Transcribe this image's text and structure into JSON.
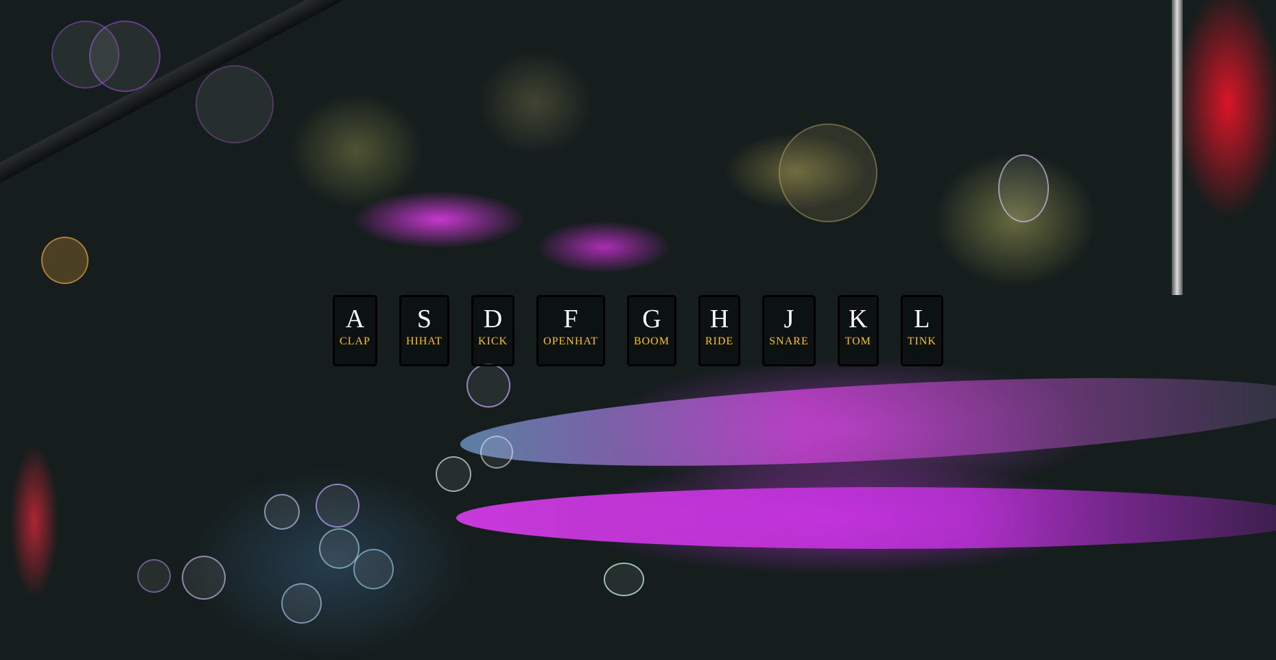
{
  "keys": [
    {
      "letter": "A",
      "sound": "CLAP"
    },
    {
      "letter": "S",
      "sound": "HIHAT"
    },
    {
      "letter": "D",
      "sound": "KICK"
    },
    {
      "letter": "F",
      "sound": "OPENHAT"
    },
    {
      "letter": "G",
      "sound": "BOOM"
    },
    {
      "letter": "H",
      "sound": "RIDE"
    },
    {
      "letter": "J",
      "sound": "SNARE"
    },
    {
      "letter": "K",
      "sound": "TOM"
    },
    {
      "letter": "L",
      "sound": "TINK"
    }
  ],
  "colors": {
    "letter": "#ffffff",
    "sound_label": "#ffc600",
    "key_border": "#000000",
    "background": "#151d1d"
  }
}
